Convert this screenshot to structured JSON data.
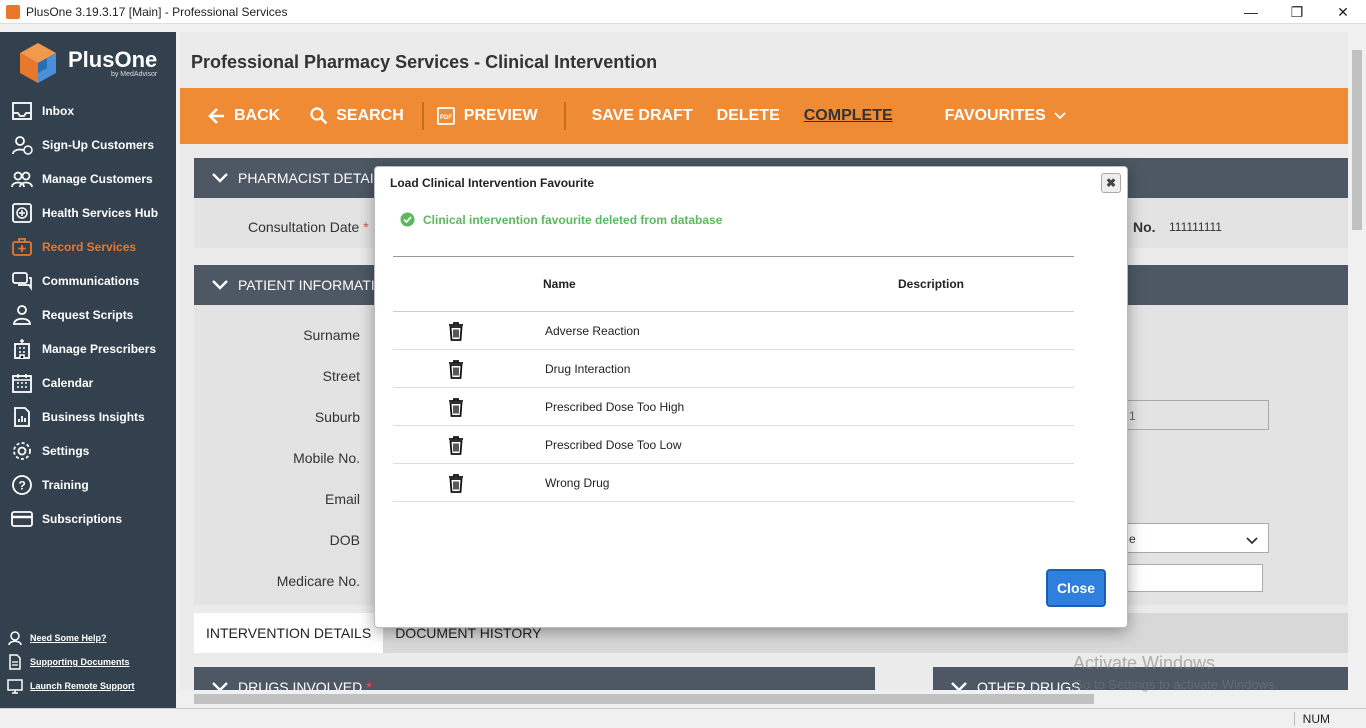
{
  "window": {
    "title": "PlusOne 3.19.3.17 [Main] - Professional Services",
    "minimize": "—",
    "restore": "❐",
    "close": "✕"
  },
  "logo": {
    "name": "PlusOne",
    "tagline": "by MedAdvisor"
  },
  "sidebar": {
    "items": [
      {
        "label": "Inbox",
        "icon": "inbox-icon"
      },
      {
        "label": "Sign-Up Customers",
        "icon": "add-user-icon"
      },
      {
        "label": "Manage Customers",
        "icon": "users-icon"
      },
      {
        "label": "Health Services Hub",
        "icon": "health-plus-icon"
      },
      {
        "label": "Record Services",
        "icon": "medical-case-icon",
        "active": true
      },
      {
        "label": "Communications",
        "icon": "chat-icon"
      },
      {
        "label": "Request Scripts",
        "icon": "doctor-icon"
      },
      {
        "label": "Manage Prescribers",
        "icon": "hospital-icon"
      },
      {
        "label": "Calendar",
        "icon": "calendar-icon"
      },
      {
        "label": "Business Insights",
        "icon": "report-icon"
      },
      {
        "label": "Settings",
        "icon": "gear-icon"
      },
      {
        "label": "Training",
        "icon": "help-circle-icon"
      },
      {
        "label": "Subscriptions",
        "icon": "card-icon"
      }
    ],
    "help": [
      {
        "label": "Need Some Help?",
        "icon": "headset-icon"
      },
      {
        "label": "Supporting Documents",
        "icon": "document-icon"
      },
      {
        "label": "Launch Remote Support",
        "icon": "monitor-icon"
      }
    ]
  },
  "page": {
    "title": "Professional Pharmacy Services - Clinical Intervention"
  },
  "toolbar": {
    "back": "BACK",
    "search": "SEARCH",
    "preview": "PREVIEW",
    "save_draft": "SAVE DRAFT",
    "delete": "DELETE",
    "complete": "COMPLETE",
    "favourites": "FAVOURITES"
  },
  "sections": {
    "pharmacist": "PHARMACIST DETAILS",
    "patient": "PATIENT INFORMATION",
    "drugs": "DRUGS INVOLVED",
    "drugs_required": "*",
    "other_drugs": "OTHER DRUGS"
  },
  "pharmacist_form": {
    "consultation_date_label": "Consultation Date",
    "required_mark": "*",
    "no_label": "No.",
    "no_value": "111111111"
  },
  "patient_form": {
    "labels": [
      "Surname",
      "Street",
      "Suburb",
      "Mobile No.",
      "Email",
      "DOB",
      "Medicare No."
    ],
    "field_fragment": "1",
    "select_fragment": "e"
  },
  "tabs": [
    {
      "label": "INTERVENTION DETAILS",
      "active": true
    },
    {
      "label": "DOCUMENT HISTORY",
      "active": false
    }
  ],
  "modal": {
    "title": "Load Clinical Intervention Favourite",
    "message": "Clinical intervention favourite deleted from database",
    "col_name": "Name",
    "col_description": "Description",
    "rows": [
      {
        "name": "Adverse Reaction",
        "description": ""
      },
      {
        "name": "Drug Interaction",
        "description": ""
      },
      {
        "name": "Prescribed Dose Too High",
        "description": ""
      },
      {
        "name": "Prescribed Dose Too Low",
        "description": ""
      },
      {
        "name": "Wrong Drug",
        "description": ""
      }
    ],
    "close_x": "✖",
    "close_button": "Close"
  },
  "status": {
    "num": "NUM"
  },
  "watermark": {
    "line1": "Activate Windows",
    "line2": "Go to Settings to activate Windows."
  },
  "colors": {
    "accent": "#ef8a35",
    "sidebar": "#33404d",
    "section": "#4d5864",
    "success": "#5cb85c",
    "primary": "#2f7fdc"
  }
}
